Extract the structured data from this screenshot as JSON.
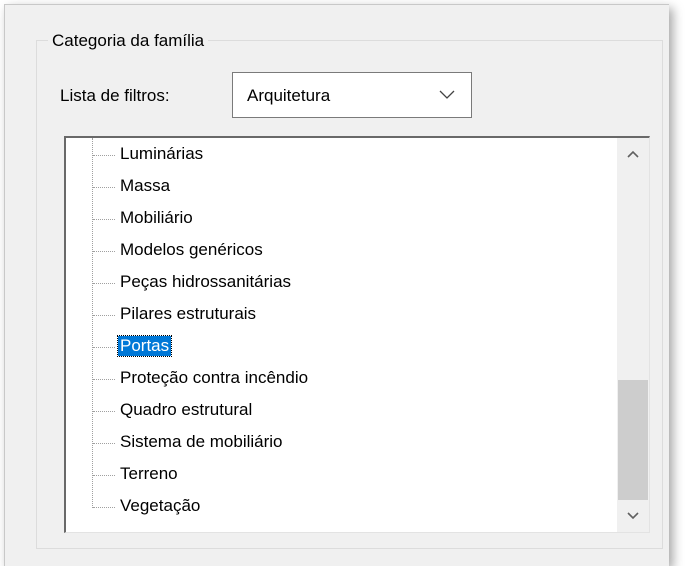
{
  "group": {
    "title": "Categoria da família"
  },
  "filter": {
    "label": "Lista de filtros:",
    "value": "Arquitetura"
  },
  "tree": {
    "items": [
      {
        "label": "Luminárias",
        "selected": false
      },
      {
        "label": "Massa",
        "selected": false
      },
      {
        "label": "Mobiliário",
        "selected": false
      },
      {
        "label": "Modelos genéricos",
        "selected": false
      },
      {
        "label": "Peças hidrossanitárias",
        "selected": false
      },
      {
        "label": "Pilares estruturais",
        "selected": false
      },
      {
        "label": "Portas",
        "selected": true
      },
      {
        "label": "Proteção contra incêndio",
        "selected": false
      },
      {
        "label": "Quadro estrutural",
        "selected": false
      },
      {
        "label": "Sistema de mobiliário",
        "selected": false
      },
      {
        "label": "Terreno",
        "selected": false
      },
      {
        "label": "Vegetação",
        "selected": false
      }
    ],
    "scroll_position": 1.0
  },
  "colors": {
    "selection": "#0078d7",
    "scroll_thumb": "#cdcdcd"
  }
}
